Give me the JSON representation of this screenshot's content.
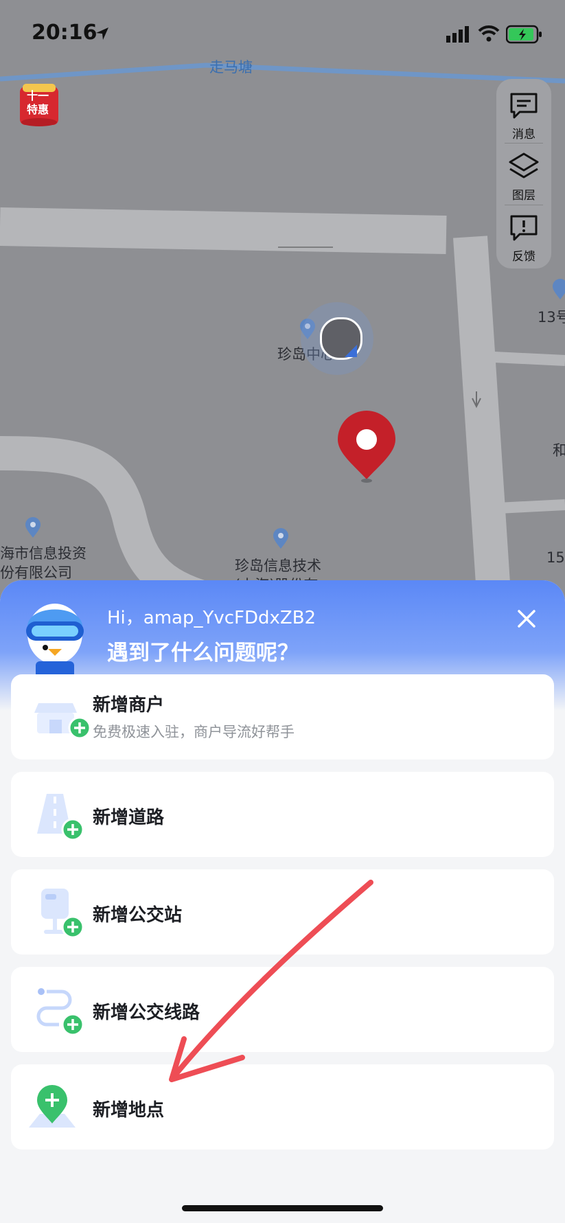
{
  "status_bar": {
    "time": "20:16"
  },
  "map": {
    "road_label": "走马塘",
    "poi_current": "珍岛中心",
    "poi_left_line1": "海市信息投资",
    "poi_left_line2": "份有限公司",
    "poi_bottom_line1": "珍岛信息技术",
    "poi_bottom_line2": "(上海)股份有",
    "poi_right_top": "13号",
    "poi_right_mid": "和",
    "poi_right_bottom": "15",
    "promo_line1": "十一",
    "promo_line2": "特惠"
  },
  "tools": {
    "message_label": "消息",
    "layers_label": "图层",
    "feedback_label": "反馈"
  },
  "sheet": {
    "greeting": "Hi，amap_YvcFDdxZB2",
    "question": "遇到了什么问题呢？",
    "options": [
      {
        "title": "新增商户",
        "subtitle": "免费极速入驻，商户导流好帮手"
      },
      {
        "title": "新增道路"
      },
      {
        "title": "新增公交站"
      },
      {
        "title": "新增公交线路"
      },
      {
        "title": "新增地点"
      }
    ]
  },
  "colors": {
    "accent_blue": "#5b88f6",
    "plus_green": "#39c16c",
    "pin_red": "#c42029",
    "annotation_red": "#ee4d55"
  }
}
